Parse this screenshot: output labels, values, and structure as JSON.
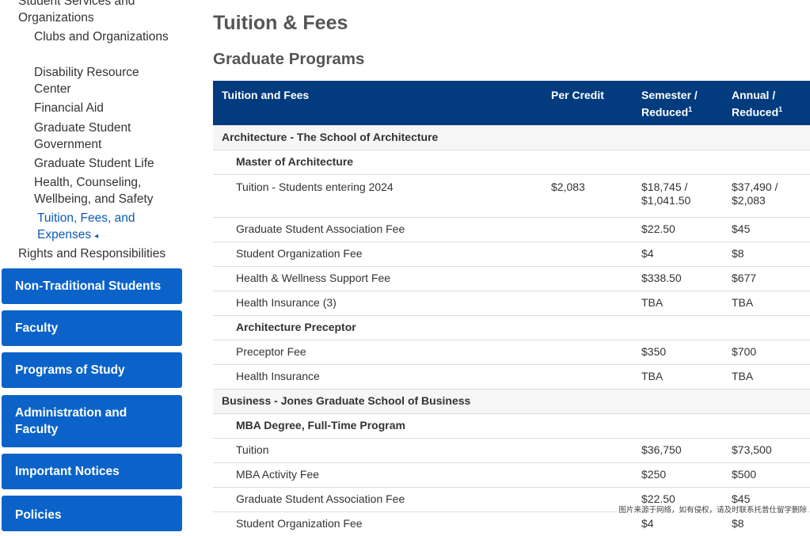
{
  "sidebar": {
    "parent_label_line1": "Student Services and",
    "parent_label_line2": "Organizations",
    "items": [
      {
        "label": "Clubs and Organizations"
      },
      {
        "label": "Disability Resource Center"
      },
      {
        "label": "Financial Aid"
      },
      {
        "label": "Graduate Student Government"
      },
      {
        "label": "Graduate Student Life"
      },
      {
        "label": "Health, Counseling, Wellbeing, and Safety"
      }
    ],
    "active_item": {
      "label": "Tuition, Fees, and Expenses",
      "caret": "◂"
    },
    "sibling_label": "Rights and Responsibilities",
    "buttons": [
      {
        "label": "Non-Traditional Students"
      },
      {
        "label": "Faculty"
      },
      {
        "label": "Programs of Study"
      },
      {
        "label": "Administration and Faculty"
      },
      {
        "label": "Important Notices"
      },
      {
        "label": "Policies"
      }
    ]
  },
  "main": {
    "title": "Tuition & Fees",
    "section_title": "Graduate Programs",
    "table": {
      "headers": {
        "col1": "Tuition and Fees",
        "col2": "Per Credit",
        "col3": "Semester / Reduced",
        "col4": "Annual / Reduced",
        "footnote_mark": "1"
      },
      "rows": [
        {
          "kind": "group",
          "label": "Architecture - The School of Architecture"
        },
        {
          "kind": "subgroup",
          "label": "Master of Architecture"
        },
        {
          "kind": "item",
          "label": "Tuition - Students entering 2024",
          "per_credit": "$2,083",
          "semester": "$18,745 / $1,041.50",
          "annual": "$37,490 / $2,083"
        },
        {
          "kind": "item",
          "label": "Graduate Student Association Fee",
          "per_credit": "",
          "semester": "$22.50",
          "annual": "$45"
        },
        {
          "kind": "item",
          "label": "Student Organization Fee",
          "per_credit": "",
          "semester": "$4",
          "annual": "$8"
        },
        {
          "kind": "item",
          "label": "Health & Wellness Support Fee",
          "per_credit": "",
          "semester": "$338.50",
          "annual": "$677"
        },
        {
          "kind": "item",
          "label": "Health Insurance (3)",
          "per_credit": "",
          "semester": "TBA",
          "annual": "TBA"
        },
        {
          "kind": "subgroup",
          "label": "Architecture Preceptor"
        },
        {
          "kind": "item",
          "label": "Preceptor Fee",
          "per_credit": "",
          "semester": "$350",
          "annual": "$700"
        },
        {
          "kind": "item",
          "label": "Health Insurance",
          "per_credit": "",
          "semester": "TBA",
          "annual": "TBA"
        },
        {
          "kind": "group",
          "label": "Business - Jones Graduate School of Business"
        },
        {
          "kind": "subgroup",
          "label": "MBA Degree, Full-Time Program"
        },
        {
          "kind": "item",
          "label": "Tuition",
          "per_credit": "",
          "semester": "$36,750",
          "annual": "$73,500"
        },
        {
          "kind": "item",
          "label": "MBA Activity Fee",
          "per_credit": "",
          "semester": "$250",
          "annual": "$500"
        },
        {
          "kind": "item",
          "label": "Graduate Student Association Fee",
          "per_credit": "",
          "semester": "$22.50",
          "annual": "$45"
        },
        {
          "kind": "item",
          "label": "Student Organization Fee",
          "per_credit": "",
          "semester": "$4",
          "annual": "$8"
        }
      ]
    }
  },
  "watermark": "图片来源于网络，如有侵权，请及时联系托普仕留学删除"
}
